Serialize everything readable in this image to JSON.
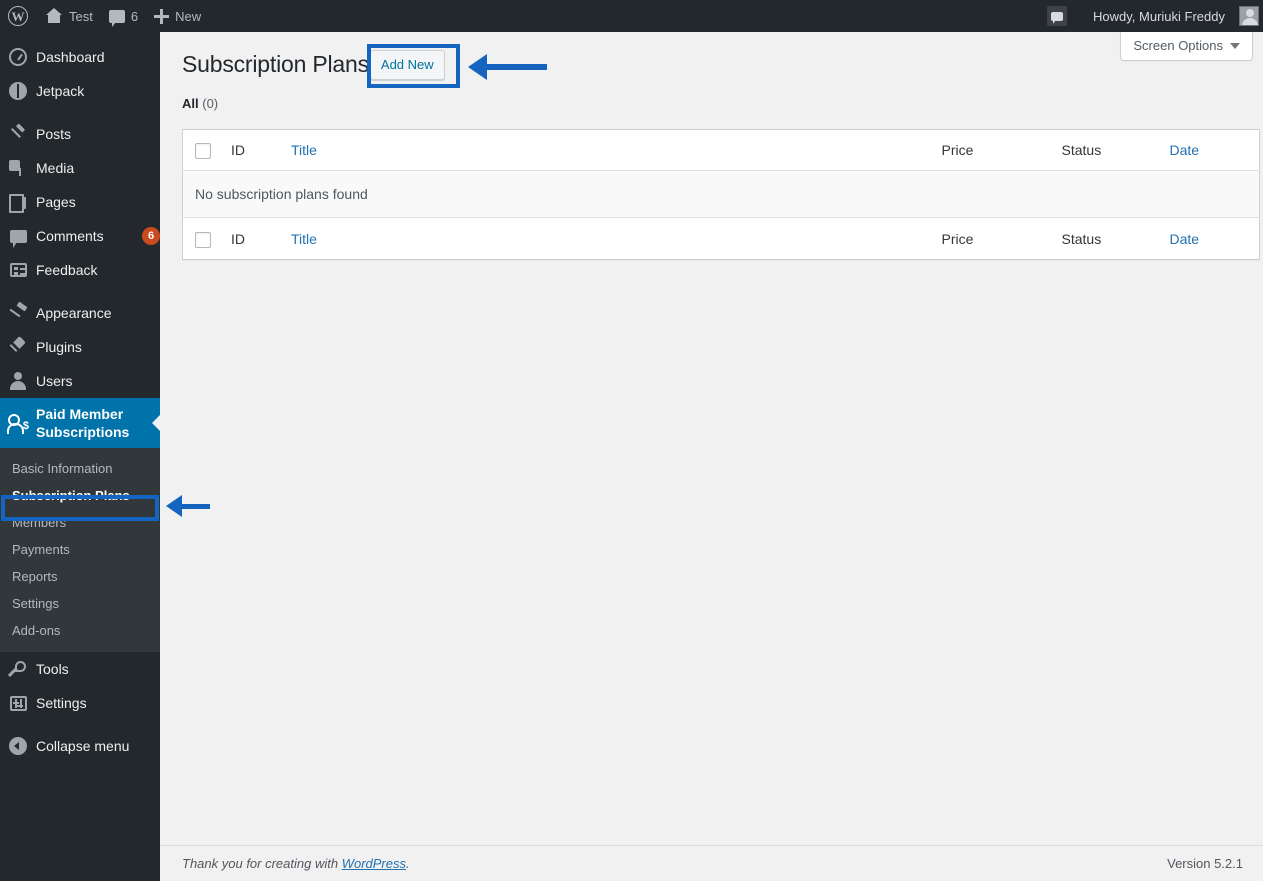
{
  "adminbar": {
    "logo_icon": "wordpress-logo-icon",
    "site_name": "Test",
    "home_icon": "home-icon",
    "comments_icon": "comment-bubble-icon",
    "comments_count": "6",
    "new_icon": "plus-icon",
    "new_label": "New",
    "notifications_icon": "comment-bubble-icon",
    "howdy": "Howdy, Muriuki Freddy",
    "avatar": "user-avatar"
  },
  "sidebar": {
    "items": [
      {
        "label": "Dashboard",
        "icon": "dashboard-icon",
        "key": "dashboard"
      },
      {
        "label": "Jetpack",
        "icon": "jetpack-icon",
        "key": "jetpack"
      },
      {
        "label": "Posts",
        "icon": "pin-icon",
        "key": "posts"
      },
      {
        "label": "Media",
        "icon": "media-icon",
        "key": "media"
      },
      {
        "label": "Pages",
        "icon": "pages-icon",
        "key": "pages"
      },
      {
        "label": "Comments",
        "icon": "comment-icon",
        "key": "comments",
        "badge": "6"
      },
      {
        "label": "Feedback",
        "icon": "feedback-icon",
        "key": "feedback"
      },
      {
        "label": "Appearance",
        "icon": "paintbrush-icon",
        "key": "appearance"
      },
      {
        "label": "Plugins",
        "icon": "plug-icon",
        "key": "plugins"
      },
      {
        "label": "Users",
        "icon": "user-icon",
        "key": "users"
      },
      {
        "label": "Paid Member Subscriptions",
        "icon": "member-dollar-icon",
        "key": "pms",
        "current": true
      },
      {
        "label": "Tools",
        "icon": "wrench-icon",
        "key": "tools"
      },
      {
        "label": "Settings",
        "icon": "sliders-icon",
        "key": "settings"
      },
      {
        "label": "Collapse menu",
        "icon": "collapse-arrow-icon",
        "key": "collapse"
      }
    ],
    "submenu": [
      {
        "label": "Basic Information",
        "key": "basic-information"
      },
      {
        "label": "Subscription Plans",
        "key": "subscription-plans",
        "current": true
      },
      {
        "label": "Members",
        "key": "members"
      },
      {
        "label": "Payments",
        "key": "payments"
      },
      {
        "label": "Reports",
        "key": "reports"
      },
      {
        "label": "Settings",
        "key": "settings"
      },
      {
        "label": "Add-ons",
        "key": "add-ons"
      }
    ]
  },
  "screen_meta": {
    "screen_options_label": "Screen Options",
    "caret_icon": "chevron-down-icon"
  },
  "page": {
    "title": "Subscription Plans",
    "add_new_label": "Add New",
    "filter_all_label": "All",
    "filter_all_count": "(0)"
  },
  "table": {
    "columns": {
      "cb": "select-all-checkbox",
      "id": "ID",
      "title": "Title",
      "price": "Price",
      "status": "Status",
      "date": "Date"
    },
    "rows": [],
    "empty_message": "No subscription plans found"
  },
  "footer": {
    "thanks_prefix": "Thank you for creating with ",
    "wordpress_link": "WordPress",
    "thanks_suffix": ".",
    "version": "Version 5.2.1"
  },
  "annotations": {
    "accent_color": "#1464c0",
    "box_add_new": "highlight-add-new-button",
    "arrow_add_new": "arrow-pointing-to-add-new",
    "box_subscription_plans": "highlight-subscription-plans-menu",
    "arrow_subscription_plans": "arrow-pointing-to-subscription-plans"
  },
  "colors": {
    "wp_blue": "#0073aa",
    "link_blue": "#2271b1",
    "badge_orange": "#ca4a1f",
    "sidebar_dark": "#23282d",
    "submenu_dark": "#32373c"
  }
}
